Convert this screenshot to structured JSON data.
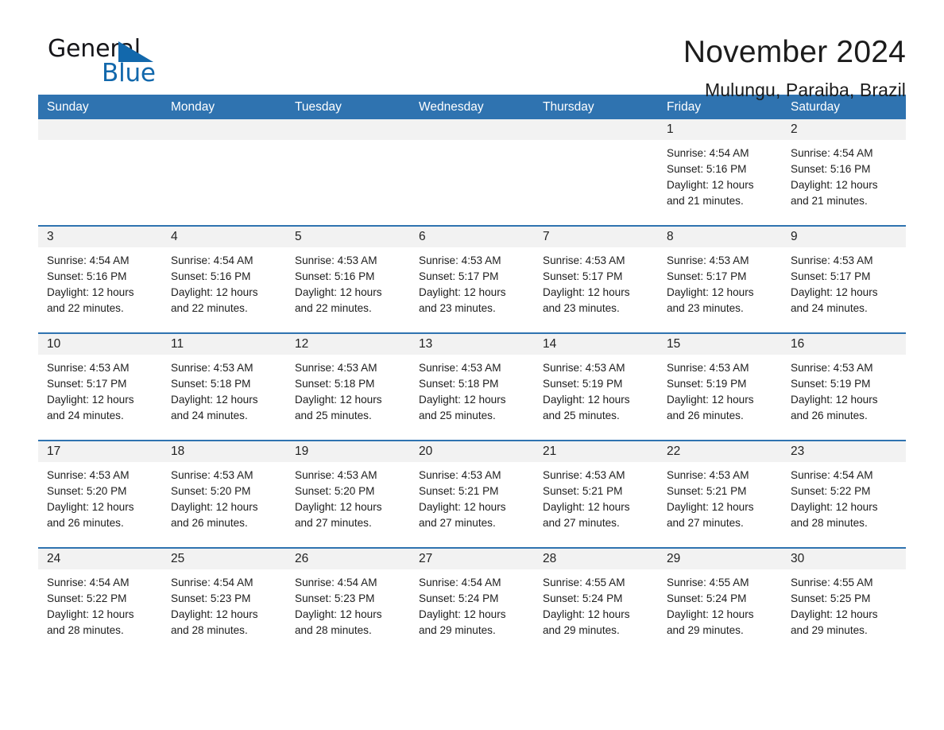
{
  "brand": {
    "name_part1": "General",
    "name_part2": "Blue",
    "triangle_icon": "brand-triangle-icon",
    "color_dark": "#16161a",
    "color_blue": "#1268ac"
  },
  "header": {
    "title": "November 2024",
    "subtitle": "Mulungu, Paraiba, Brazil"
  },
  "theme": {
    "header_blue": "#2f73b0",
    "day_band_gray": "#f2f2f2",
    "text": "#1d1d1d"
  },
  "weekdays": [
    "Sunday",
    "Monday",
    "Tuesday",
    "Wednesday",
    "Thursday",
    "Friday",
    "Saturday"
  ],
  "weeks": [
    [
      {
        "day": "",
        "empty": true
      },
      {
        "day": "",
        "empty": true
      },
      {
        "day": "",
        "empty": true
      },
      {
        "day": "",
        "empty": true
      },
      {
        "day": "",
        "empty": true
      },
      {
        "day": "1",
        "sunrise": "Sunrise: 4:54 AM",
        "sunset": "Sunset: 5:16 PM",
        "daylight_1": "Daylight: 12 hours",
        "daylight_2": "and 21 minutes."
      },
      {
        "day": "2",
        "sunrise": "Sunrise: 4:54 AM",
        "sunset": "Sunset: 5:16 PM",
        "daylight_1": "Daylight: 12 hours",
        "daylight_2": "and 21 minutes."
      }
    ],
    [
      {
        "day": "3",
        "sunrise": "Sunrise: 4:54 AM",
        "sunset": "Sunset: 5:16 PM",
        "daylight_1": "Daylight: 12 hours",
        "daylight_2": "and 22 minutes."
      },
      {
        "day": "4",
        "sunrise": "Sunrise: 4:54 AM",
        "sunset": "Sunset: 5:16 PM",
        "daylight_1": "Daylight: 12 hours",
        "daylight_2": "and 22 minutes."
      },
      {
        "day": "5",
        "sunrise": "Sunrise: 4:53 AM",
        "sunset": "Sunset: 5:16 PM",
        "daylight_1": "Daylight: 12 hours",
        "daylight_2": "and 22 minutes."
      },
      {
        "day": "6",
        "sunrise": "Sunrise: 4:53 AM",
        "sunset": "Sunset: 5:17 PM",
        "daylight_1": "Daylight: 12 hours",
        "daylight_2": "and 23 minutes."
      },
      {
        "day": "7",
        "sunrise": "Sunrise: 4:53 AM",
        "sunset": "Sunset: 5:17 PM",
        "daylight_1": "Daylight: 12 hours",
        "daylight_2": "and 23 minutes."
      },
      {
        "day": "8",
        "sunrise": "Sunrise: 4:53 AM",
        "sunset": "Sunset: 5:17 PM",
        "daylight_1": "Daylight: 12 hours",
        "daylight_2": "and 23 minutes."
      },
      {
        "day": "9",
        "sunrise": "Sunrise: 4:53 AM",
        "sunset": "Sunset: 5:17 PM",
        "daylight_1": "Daylight: 12 hours",
        "daylight_2": "and 24 minutes."
      }
    ],
    [
      {
        "day": "10",
        "sunrise": "Sunrise: 4:53 AM",
        "sunset": "Sunset: 5:17 PM",
        "daylight_1": "Daylight: 12 hours",
        "daylight_2": "and 24 minutes."
      },
      {
        "day": "11",
        "sunrise": "Sunrise: 4:53 AM",
        "sunset": "Sunset: 5:18 PM",
        "daylight_1": "Daylight: 12 hours",
        "daylight_2": "and 24 minutes."
      },
      {
        "day": "12",
        "sunrise": "Sunrise: 4:53 AM",
        "sunset": "Sunset: 5:18 PM",
        "daylight_1": "Daylight: 12 hours",
        "daylight_2": "and 25 minutes."
      },
      {
        "day": "13",
        "sunrise": "Sunrise: 4:53 AM",
        "sunset": "Sunset: 5:18 PM",
        "daylight_1": "Daylight: 12 hours",
        "daylight_2": "and 25 minutes."
      },
      {
        "day": "14",
        "sunrise": "Sunrise: 4:53 AM",
        "sunset": "Sunset: 5:19 PM",
        "daylight_1": "Daylight: 12 hours",
        "daylight_2": "and 25 minutes."
      },
      {
        "day": "15",
        "sunrise": "Sunrise: 4:53 AM",
        "sunset": "Sunset: 5:19 PM",
        "daylight_1": "Daylight: 12 hours",
        "daylight_2": "and 26 minutes."
      },
      {
        "day": "16",
        "sunrise": "Sunrise: 4:53 AM",
        "sunset": "Sunset: 5:19 PM",
        "daylight_1": "Daylight: 12 hours",
        "daylight_2": "and 26 minutes."
      }
    ],
    [
      {
        "day": "17",
        "sunrise": "Sunrise: 4:53 AM",
        "sunset": "Sunset: 5:20 PM",
        "daylight_1": "Daylight: 12 hours",
        "daylight_2": "and 26 minutes."
      },
      {
        "day": "18",
        "sunrise": "Sunrise: 4:53 AM",
        "sunset": "Sunset: 5:20 PM",
        "daylight_1": "Daylight: 12 hours",
        "daylight_2": "and 26 minutes."
      },
      {
        "day": "19",
        "sunrise": "Sunrise: 4:53 AM",
        "sunset": "Sunset: 5:20 PM",
        "daylight_1": "Daylight: 12 hours",
        "daylight_2": "and 27 minutes."
      },
      {
        "day": "20",
        "sunrise": "Sunrise: 4:53 AM",
        "sunset": "Sunset: 5:21 PM",
        "daylight_1": "Daylight: 12 hours",
        "daylight_2": "and 27 minutes."
      },
      {
        "day": "21",
        "sunrise": "Sunrise: 4:53 AM",
        "sunset": "Sunset: 5:21 PM",
        "daylight_1": "Daylight: 12 hours",
        "daylight_2": "and 27 minutes."
      },
      {
        "day": "22",
        "sunrise": "Sunrise: 4:53 AM",
        "sunset": "Sunset: 5:21 PM",
        "daylight_1": "Daylight: 12 hours",
        "daylight_2": "and 27 minutes."
      },
      {
        "day": "23",
        "sunrise": "Sunrise: 4:54 AM",
        "sunset": "Sunset: 5:22 PM",
        "daylight_1": "Daylight: 12 hours",
        "daylight_2": "and 28 minutes."
      }
    ],
    [
      {
        "day": "24",
        "sunrise": "Sunrise: 4:54 AM",
        "sunset": "Sunset: 5:22 PM",
        "daylight_1": "Daylight: 12 hours",
        "daylight_2": "and 28 minutes."
      },
      {
        "day": "25",
        "sunrise": "Sunrise: 4:54 AM",
        "sunset": "Sunset: 5:23 PM",
        "daylight_1": "Daylight: 12 hours",
        "daylight_2": "and 28 minutes."
      },
      {
        "day": "26",
        "sunrise": "Sunrise: 4:54 AM",
        "sunset": "Sunset: 5:23 PM",
        "daylight_1": "Daylight: 12 hours",
        "daylight_2": "and 28 minutes."
      },
      {
        "day": "27",
        "sunrise": "Sunrise: 4:54 AM",
        "sunset": "Sunset: 5:24 PM",
        "daylight_1": "Daylight: 12 hours",
        "daylight_2": "and 29 minutes."
      },
      {
        "day": "28",
        "sunrise": "Sunrise: 4:55 AM",
        "sunset": "Sunset: 5:24 PM",
        "daylight_1": "Daylight: 12 hours",
        "daylight_2": "and 29 minutes."
      },
      {
        "day": "29",
        "sunrise": "Sunrise: 4:55 AM",
        "sunset": "Sunset: 5:24 PM",
        "daylight_1": "Daylight: 12 hours",
        "daylight_2": "and 29 minutes."
      },
      {
        "day": "30",
        "sunrise": "Sunrise: 4:55 AM",
        "sunset": "Sunset: 5:25 PM",
        "daylight_1": "Daylight: 12 hours",
        "daylight_2": "and 29 minutes."
      }
    ]
  ]
}
